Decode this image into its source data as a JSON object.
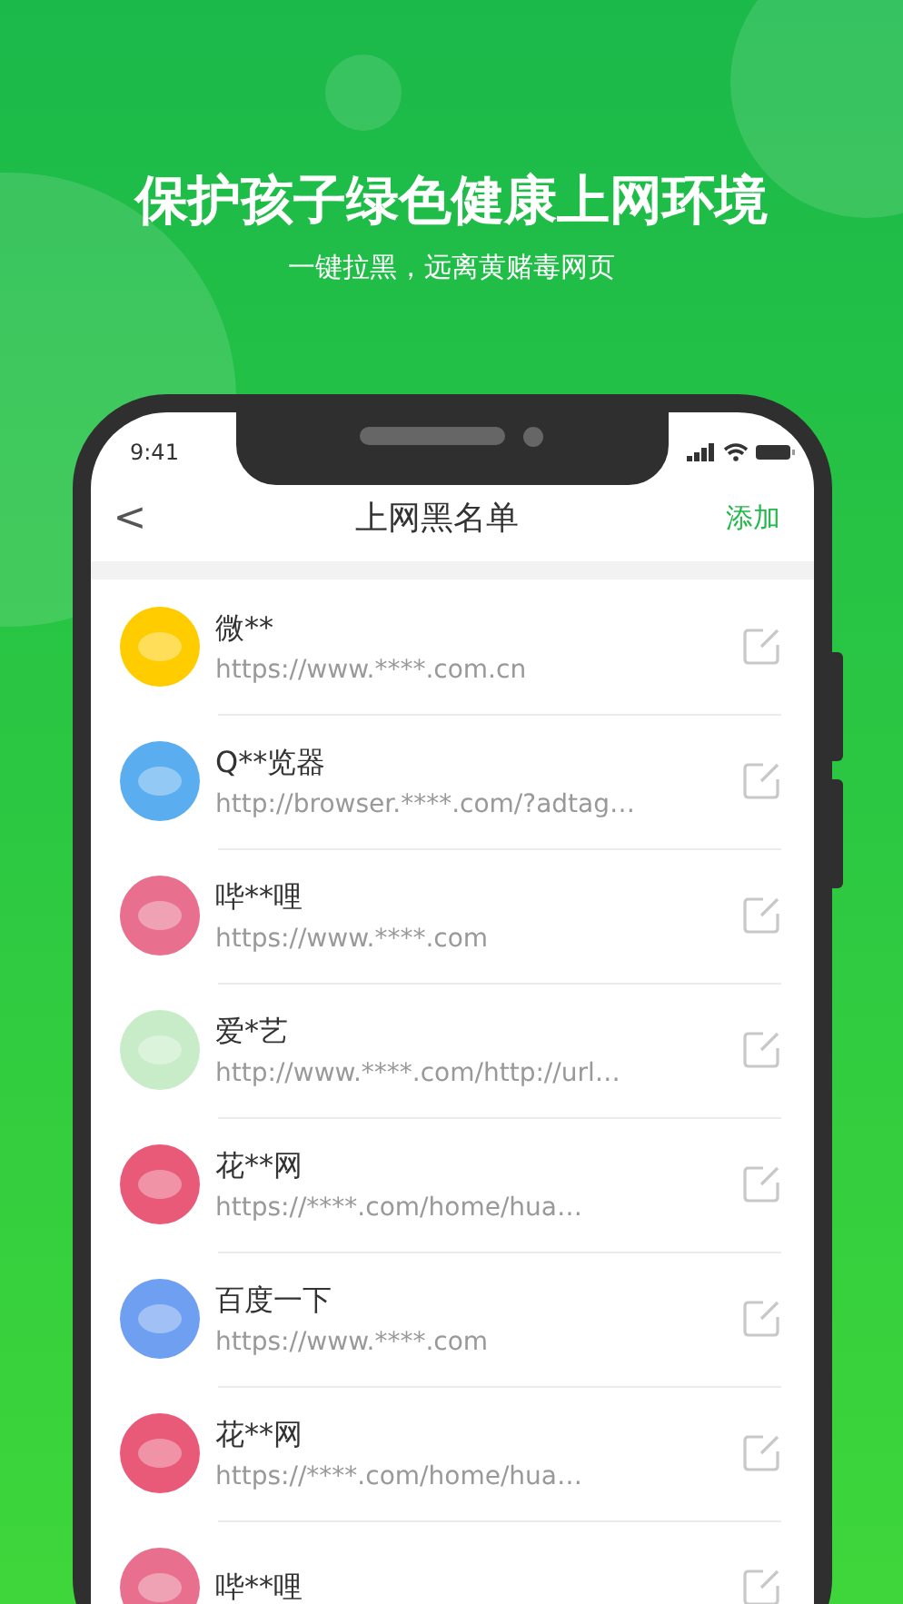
{
  "headline": "保护孩子绿色健康上网环境",
  "subheadline": "一键拉黑，远离黄赌毒网页",
  "status_bar": {
    "time": "9:41"
  },
  "nav": {
    "back": "<",
    "title": "上网黑名单",
    "action": "添加"
  },
  "sites": [
    {
      "name": "微**",
      "url": "https://www.****.com.cn",
      "color": "#ffcc00"
    },
    {
      "name": "Q**览器",
      "url": "http://browser.****.com/?adtag…",
      "color": "#5aaef0"
    },
    {
      "name": "哔**哩",
      "url": "https://www.****.com",
      "color": "#e8708e"
    },
    {
      "name": "爱*艺",
      "url": "http://www.****.com/http://url…",
      "color": "#c8ecc8"
    },
    {
      "name": "花**网",
      "url": "https://****.com/home/hua…",
      "color": "#e85a78"
    },
    {
      "name": "百度一下",
      "url": "https://www.****.com",
      "color": "#6f9ff0"
    },
    {
      "name": "花**网",
      "url": "https://****.com/home/hua…",
      "color": "#e85a78"
    },
    {
      "name": "哔**哩",
      "color": "#e8708e"
    }
  ]
}
